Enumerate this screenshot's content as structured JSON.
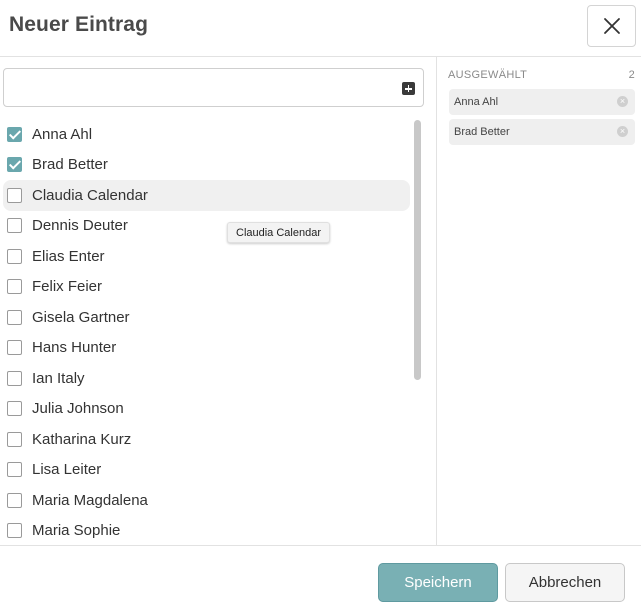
{
  "dialog": {
    "title": "Neuer Eintrag",
    "close_icon": "close-icon"
  },
  "search": {
    "value": "",
    "placeholder": "",
    "add_icon": "plus-square-icon"
  },
  "list": {
    "items": [
      {
        "label": "Anna Ahl",
        "checked": true
      },
      {
        "label": "Brad Better",
        "checked": true
      },
      {
        "label": "Claudia Calendar",
        "checked": false,
        "hovered": true
      },
      {
        "label": "Dennis Deuter",
        "checked": false
      },
      {
        "label": "Elias Enter",
        "checked": false
      },
      {
        "label": "Felix Feier",
        "checked": false
      },
      {
        "label": "Gisela Gartner",
        "checked": false
      },
      {
        "label": "Hans Hunter",
        "checked": false
      },
      {
        "label": "Ian Italy",
        "checked": false
      },
      {
        "label": "Julia Johnson",
        "checked": false
      },
      {
        "label": "Katharina Kurz",
        "checked": false
      },
      {
        "label": "Lisa Leiter",
        "checked": false
      },
      {
        "label": "Maria Magdalena",
        "checked": false
      },
      {
        "label": "Maria Sophie",
        "checked": false
      }
    ],
    "tooltip": "Claudia Calendar"
  },
  "selected": {
    "header": "AUSGEWÄHLT",
    "count": "2",
    "chips": [
      {
        "label": "Anna Ahl"
      },
      {
        "label": "Brad Better"
      }
    ]
  },
  "footer": {
    "save_label": "Speichern",
    "cancel_label": "Abbrechen"
  },
  "colors": {
    "accent": "#79b0b4",
    "checkbox_checked": "#6aa7ad"
  }
}
